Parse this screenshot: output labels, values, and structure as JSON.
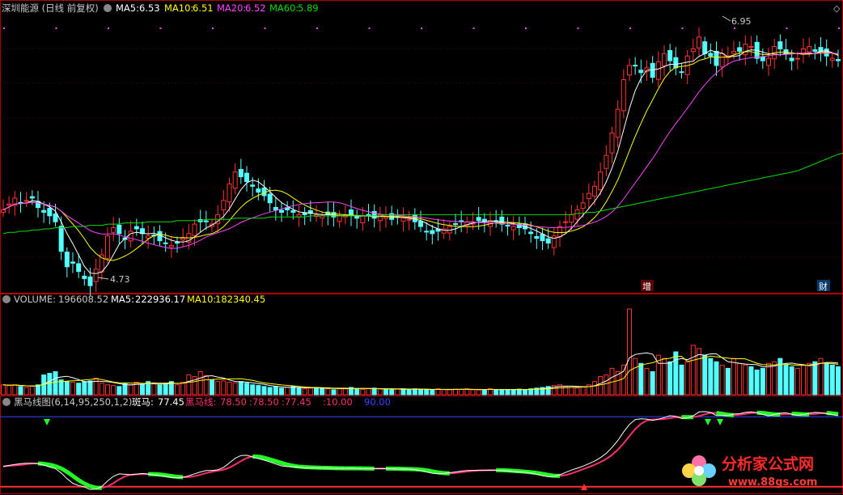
{
  "colors": {
    "up": "#ff3232",
    "down": "#54ffff",
    "ma5": "#ffffff",
    "ma10": "#ffff00",
    "ma20": "#ff44ff",
    "ma60": "#00dd00",
    "frame": "#b00000",
    "text": "#c8c8c8",
    "zebra_up": "#ff2e6e",
    "zebra_dn": "#22ff22",
    "panel_blue": "#3344ff"
  },
  "price_panel": {
    "title": "深圳能源 (日线 前复权)",
    "ma5_label": "MA5:",
    "ma5_value": "6.53",
    "ma10_label": "MA10:",
    "ma10_value": "6.51",
    "ma20_label": "MA20:",
    "ma20_value": "6.52",
    "ma60_label": "MA60:",
    "ma60_value": "5.89",
    "high_label": "6.95",
    "low_label": "4.73",
    "flag_zeng": "增",
    "flag_cai": "财"
  },
  "volume_panel": {
    "title": "VOLUME:",
    "volume_value": "196608.52",
    "ma5_label": "MA5:",
    "ma5_value": "222936.17",
    "ma10_label": "MA10:",
    "ma10_value": "182340.45"
  },
  "indicator_panel": {
    "title": "黑马线图(6,14,95,250,1,2)",
    "zebra_label": "斑马:",
    "zebra_value": "77.45",
    "horse_label": "黑马线:",
    "horse_value": "78.50",
    "sep1": ":78.50",
    "sep2": ":77.45",
    "level_low": ":10.00",
    "level_high": "90.00"
  },
  "watermark": {
    "text": "分析家公式网",
    "url": "www.88gs.com"
  },
  "chart_data": {
    "type": "candlestick",
    "series_count": 145,
    "price_range": [
      4.7,
      7.05
    ],
    "notable_high": 6.95,
    "notable_low": 4.73,
    "closes": [
      5.4,
      5.45,
      5.5,
      5.46,
      5.48,
      5.5,
      5.42,
      5.38,
      5.35,
      5.3,
      5.05,
      4.92,
      4.95,
      4.88,
      4.82,
      4.76,
      4.9,
      5.02,
      5.18,
      5.25,
      5.2,
      5.15,
      5.22,
      5.24,
      5.2,
      5.18,
      5.18,
      5.14,
      5.12,
      5.1,
      5.12,
      5.16,
      5.2,
      5.28,
      5.3,
      5.3,
      5.28,
      5.36,
      5.48,
      5.62,
      5.72,
      5.68,
      5.64,
      5.6,
      5.55,
      5.52,
      5.46,
      5.4,
      5.38,
      5.4,
      5.38,
      5.36,
      5.36,
      5.37,
      5.36,
      5.35,
      5.36,
      5.34,
      5.35,
      5.36,
      5.35,
      5.33,
      5.35,
      5.35,
      5.33,
      5.36,
      5.34,
      5.32,
      5.34,
      5.33,
      5.32,
      5.3,
      5.26,
      5.22,
      5.2,
      5.22,
      5.24,
      5.26,
      5.28,
      5.3,
      5.3,
      5.3,
      5.31,
      5.3,
      5.31,
      5.3,
      5.28,
      5.27,
      5.26,
      5.25,
      5.24,
      5.2,
      5.16,
      5.14,
      5.12,
      5.18,
      5.26,
      5.3,
      5.36,
      5.4,
      5.46,
      5.54,
      5.6,
      5.72,
      5.86,
      6.05,
      6.25,
      6.5,
      6.62,
      6.62,
      6.56,
      6.6,
      6.52,
      6.65,
      6.72,
      6.66,
      6.6,
      6.56,
      6.7,
      6.76,
      6.86,
      6.72,
      6.7,
      6.62,
      6.72,
      6.7,
      6.74,
      6.74,
      6.8,
      6.78,
      6.68,
      6.66,
      6.68,
      6.78,
      6.76,
      6.72,
      6.66,
      6.68,
      6.76,
      6.78,
      6.74,
      6.74,
      6.7,
      6.68,
      6.66
    ],
    "ma60": [
      5.2,
      5.21,
      5.21,
      5.22,
      5.22,
      5.23,
      5.23,
      5.24,
      5.24,
      5.25,
      5.25,
      5.25,
      5.26,
      5.26,
      5.26,
      5.27,
      5.27,
      5.27,
      5.28,
      5.28,
      5.28,
      5.29,
      5.29,
      5.29,
      5.29,
      5.3,
      5.3,
      5.3,
      5.3,
      5.3,
      5.31,
      5.31,
      5.31,
      5.31,
      5.31,
      5.32,
      5.32,
      5.32,
      5.32,
      5.32,
      5.33,
      5.33,
      5.33,
      5.33,
      5.33,
      5.33,
      5.34,
      5.34,
      5.34,
      5.34,
      5.34,
      5.34,
      5.34,
      5.35,
      5.35,
      5.35,
      5.35,
      5.35,
      5.35,
      5.35,
      5.35,
      5.35,
      5.35,
      5.35,
      5.35,
      5.35,
      5.36,
      5.36,
      5.36,
      5.36,
      5.36,
      5.36,
      5.36,
      5.36,
      5.36,
      5.36,
      5.36,
      5.36,
      5.36,
      5.36,
      5.36,
      5.36,
      5.36,
      5.36,
      5.36,
      5.36,
      5.36,
      5.36,
      5.36,
      5.36,
      5.36,
      5.36,
      5.36,
      5.36,
      5.36,
      5.36,
      5.36,
      5.36,
      5.36,
      5.37,
      5.37,
      5.38,
      5.38,
      5.39,
      5.4,
      5.41,
      5.42,
      5.43,
      5.44,
      5.45,
      5.46,
      5.47,
      5.48,
      5.49,
      5.5,
      5.51,
      5.52,
      5.53,
      5.54,
      5.55,
      5.56,
      5.57,
      5.58,
      5.59,
      5.6,
      5.61,
      5.62,
      5.63,
      5.64,
      5.65,
      5.66,
      5.67,
      5.68,
      5.69,
      5.7,
      5.71,
      5.72,
      5.73,
      5.75,
      5.77,
      5.79,
      5.81,
      5.83,
      5.85,
      5.87,
      5.88,
      5.89
    ],
    "volumes_k": [
      30,
      28,
      30,
      25,
      22,
      26,
      30,
      60,
      65,
      70,
      45,
      40,
      38,
      35,
      40,
      42,
      50,
      35,
      30,
      28,
      25,
      35,
      30,
      38,
      32,
      40,
      36,
      30,
      35,
      40,
      30,
      38,
      60,
      55,
      70,
      58,
      45,
      40,
      42,
      38,
      36,
      40,
      35,
      30,
      28,
      25,
      22,
      24,
      20,
      22,
      25,
      20,
      18,
      20,
      22,
      20,
      18,
      15,
      18,
      20,
      22,
      18,
      16,
      18,
      20,
      18,
      16,
      15,
      17,
      18,
      16,
      18,
      15,
      16,
      14,
      18,
      16,
      15,
      17,
      16,
      18,
      15,
      14,
      16,
      18,
      15,
      16,
      14,
      16,
      17,
      15,
      18,
      20,
      22,
      25,
      28,
      30,
      25,
      22,
      20,
      24,
      30,
      40,
      55,
      60,
      80,
      70,
      90,
      260,
      110,
      95,
      80,
      70,
      120,
      110,
      100,
      130,
      90,
      100,
      150,
      140,
      120,
      110,
      100,
      90,
      80,
      110,
      95,
      90,
      85,
      75,
      80,
      95,
      100,
      110,
      90,
      85,
      80,
      90,
      95,
      100,
      110,
      95,
      90,
      85
    ],
    "indicator_levels": [
      10,
      90
    ]
  }
}
